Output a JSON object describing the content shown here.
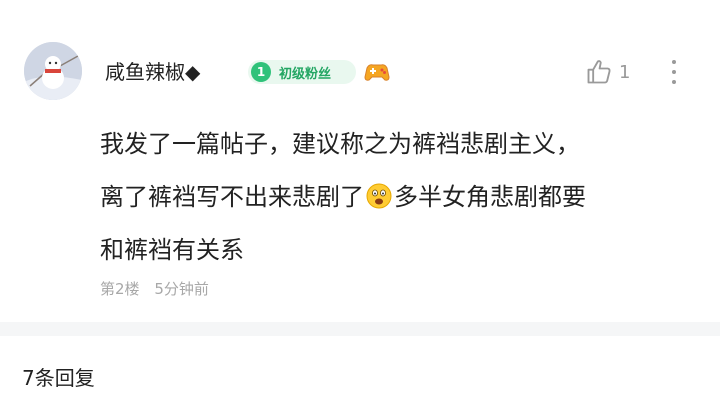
{
  "post": {
    "username": "咸鱼辣椒◆",
    "fan_badge": {
      "level": "1",
      "label": "初级粉丝"
    },
    "like_count": "1",
    "content_lines": [
      "我发了一篇帖子，建议称之为裤裆悲剧主义，",
      "离了裤裆写不出来悲剧了",
      "多半女角悲剧都要",
      "和裤裆有关系"
    ],
    "floor": "第2楼",
    "time": "5分钟前"
  },
  "replies": {
    "count_label": "7条回复"
  },
  "icons": {
    "avatar": "snowman-avatar",
    "game": "gamepad-icon",
    "like": "thumbs-up-icon",
    "more": "more-vertical-icon",
    "emoji": "surprised-emoji"
  },
  "colors": {
    "badge_green": "#2fc27a",
    "badge_bg": "#e9f8ef",
    "meta_gray": "#a8a8a8"
  }
}
